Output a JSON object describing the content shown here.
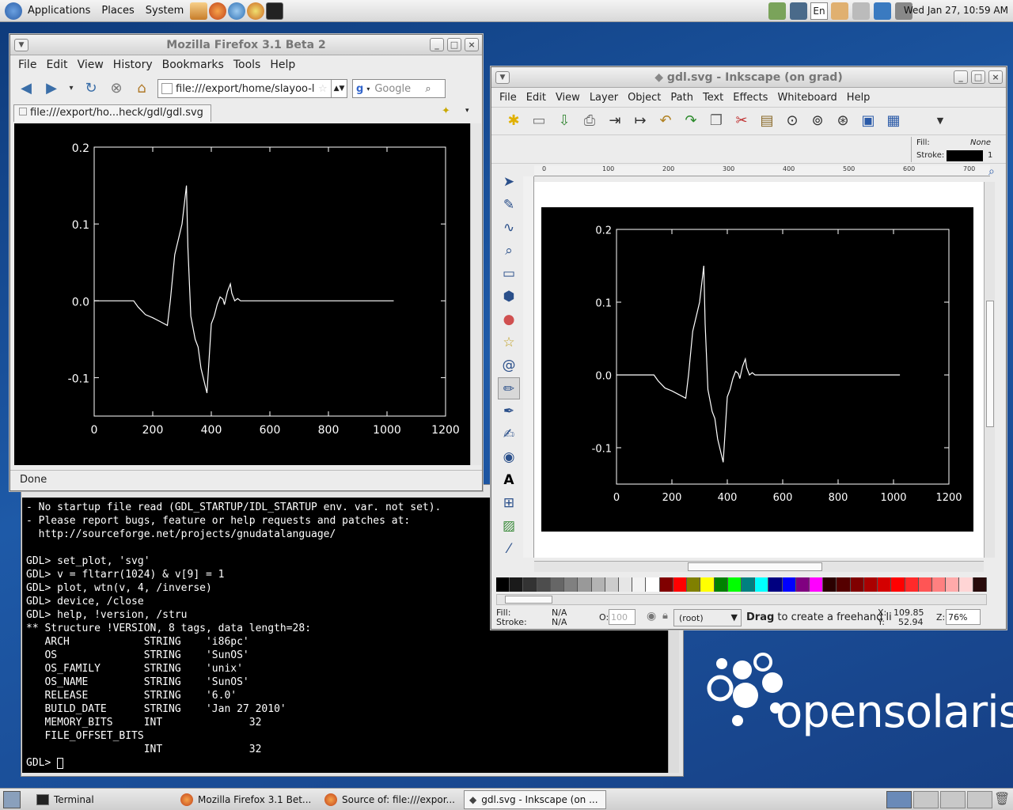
{
  "top_panel": {
    "menus": [
      "Applications",
      "Places",
      "System"
    ],
    "lang": "En",
    "clock": "Wed Jan 27, 10:59 AM"
  },
  "firefox": {
    "title": "Mozilla Firefox 3.1 Beta 2",
    "menu": [
      "File",
      "Edit",
      "View",
      "History",
      "Bookmarks",
      "Tools",
      "Help"
    ],
    "url": "file:///export/home/slayoo-l",
    "search_placeholder": "Google",
    "tab_title": "file:///export/ho...heck/gdl/gdl.svg",
    "status": "Done"
  },
  "inkscape": {
    "title": "gdl.svg - Inkscape (on grad)",
    "menu": [
      "File",
      "Edit",
      "View",
      "Layer",
      "Object",
      "Path",
      "Text",
      "Effects",
      "Whiteboard",
      "Help"
    ],
    "fill_label": "Fill:",
    "fill_value": "None",
    "stroke_label": "Stroke:",
    "stroke_width": "1",
    "ruler_marks": [
      "0",
      "100",
      "200",
      "300",
      "400",
      "500",
      "600",
      "700"
    ],
    "status": {
      "fill_label": "Fill:",
      "fill_value": "N/A",
      "stroke_label": "Stroke:",
      "stroke_value": "N/A",
      "opacity_label": "O:",
      "opacity_value": "100",
      "layer": "(root)",
      "message_bold": "Drag",
      "message_rest": " to create a freehand li",
      "x_label": "X:",
      "x_value": "109.85",
      "y_label": "Y:",
      "y_value": "52.94",
      "zoom_label": "Z:",
      "zoom_value": "76%"
    },
    "palette": [
      "#000000",
      "#1a1a1a",
      "#333333",
      "#4d4d4d",
      "#666666",
      "#808080",
      "#999999",
      "#b3b3b3",
      "#cccccc",
      "#e6e6e6",
      "#f2f2f2",
      "#ffffff",
      "#800000",
      "#ff0000",
      "#808000",
      "#ffff00",
      "#008000",
      "#00ff00",
      "#008080",
      "#00ffff",
      "#000080",
      "#0000ff",
      "#800080",
      "#ff00ff",
      "#2b0000",
      "#550000",
      "#800000",
      "#aa0000",
      "#d40000",
      "#ff0000",
      "#ff2a2a",
      "#ff5555",
      "#ff8080",
      "#ffaaaa",
      "#ffd5d5",
      "#280b0b"
    ]
  },
  "terminal": {
    "lines": [
      "- No startup file read (GDL_STARTUP/IDL_STARTUP env. var. not set).",
      "- Please report bugs, feature or help requests and patches at:",
      "  http://sourceforge.net/projects/gnudatalanguage/",
      "",
      "GDL> set_plot, 'svg'",
      "GDL> v = fltarr(1024) & v[9] = 1",
      "GDL> plot, wtn(v, 4, /inverse)",
      "GDL> device, /close",
      "GDL> help, !version, /stru",
      "** Structure !VERSION, 8 tags, data length=28:",
      "   ARCH            STRING    'i86pc'",
      "   OS              STRING    'SunOS'",
      "   OS_FAMILY       STRING    'unix'",
      "   OS_NAME         STRING    'SunOS'",
      "   RELEASE         STRING    '6.0'",
      "   BUILD_DATE      STRING    'Jan 27 2010'",
      "   MEMORY_BITS     INT              32",
      "   FILE_OFFSET_BITS",
      "                   INT              32"
    ],
    "prompt": "GDL> "
  },
  "taskbar": {
    "items": [
      "Terminal",
      "Mozilla Firefox 3.1 Bet...",
      "Source of: file:///expor...",
      "gdl.svg - Inkscape (on ..."
    ]
  },
  "desktop": {
    "logo_text": "opensolaris"
  },
  "chart_data": {
    "type": "line",
    "title": "",
    "xlabel": "",
    "ylabel": "",
    "xlim": [
      0,
      1200
    ],
    "ylim": [
      -0.15,
      0.2
    ],
    "xticks": [
      "0",
      "200",
      "400",
      "600",
      "800",
      "1000",
      "1200"
    ],
    "yticks": [
      "0.2",
      "0.1",
      "0.0",
      "-0.1"
    ],
    "x": [
      0,
      125,
      135,
      150,
      175,
      200,
      225,
      250,
      260,
      275,
      300,
      315,
      320,
      330,
      345,
      355,
      365,
      385,
      400,
      410,
      420,
      430,
      440,
      445,
      455,
      465,
      470,
      480,
      490,
      500,
      1023
    ],
    "values": [
      0,
      0,
      0,
      -0.008,
      -0.018,
      -0.022,
      -0.027,
      -0.032,
      0.0,
      0.06,
      0.1,
      0.15,
      0.07,
      -0.02,
      -0.05,
      -0.06,
      -0.088,
      -0.12,
      -0.03,
      -0.02,
      -0.005,
      0.005,
      0.002,
      -0.005,
      0.012,
      0.022,
      0.01,
      0.0,
      0.003,
      0,
      0
    ],
    "grid": false,
    "color": "#ffffff",
    "background": "#000000"
  }
}
